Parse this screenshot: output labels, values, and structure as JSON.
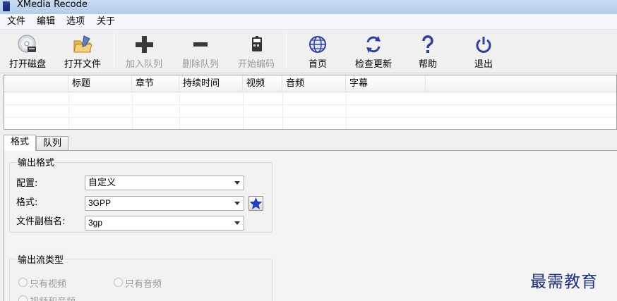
{
  "window": {
    "title": "XMedia Recode"
  },
  "menu": [
    "文件",
    "编辑",
    "选项",
    "关于"
  ],
  "toolbar": {
    "open_disc": "打开磁盘",
    "open_file": "打开文件",
    "add_queue": "加入队列",
    "remove_queue": "删除队列",
    "start_encode": "开始编码",
    "home": "首页",
    "check_update": "检查更新",
    "help": "帮助",
    "exit": "退出"
  },
  "list": {
    "columns": [
      "",
      "标题",
      "章节",
      "持续时间",
      "视频",
      "音频",
      "字幕"
    ]
  },
  "tabs": {
    "format": "格式",
    "queue": "队列"
  },
  "output_format": {
    "title": "输出格式",
    "profile_label": "配置:",
    "profile_value": "自定义",
    "format_label": "格式:",
    "format_value": "3GPP",
    "ext_label": "文件副档名:",
    "ext_value": "3gp"
  },
  "stream_type": {
    "title": "输出流类型",
    "video_only": "只有视频",
    "audio_only": "只有音频",
    "video_audio": "视频和音频"
  },
  "watermark": "最需教育",
  "colors": {
    "accent_blue": "#1c2f8c",
    "star_blue": "#1f3fd1",
    "titlebar": "#c9dcf2"
  }
}
